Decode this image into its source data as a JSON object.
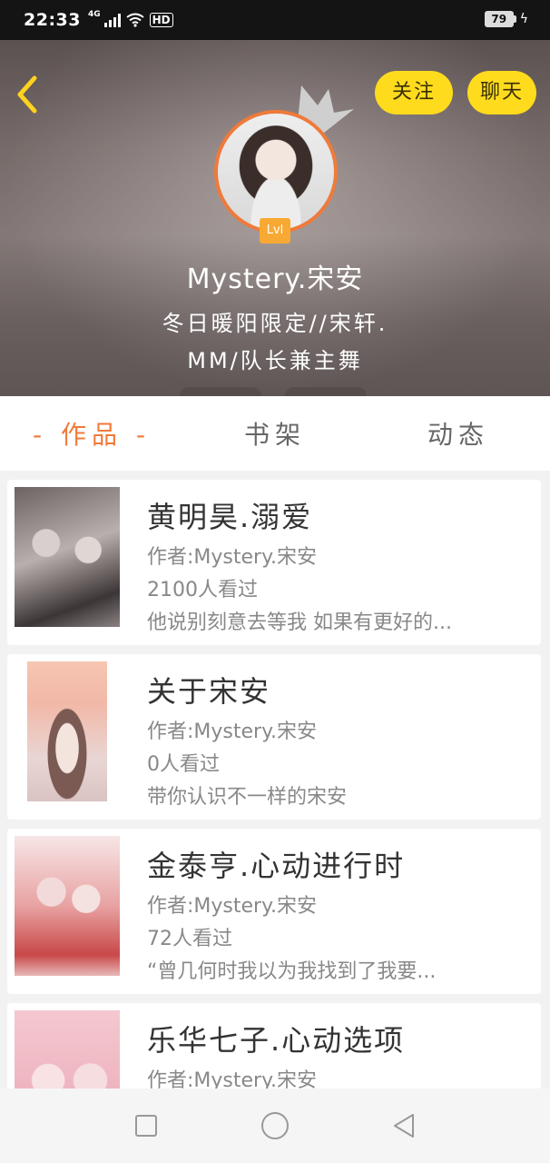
{
  "status_bar": {
    "time": "22:33",
    "network": "4G",
    "hd": "HD",
    "battery": "79"
  },
  "header": {
    "follow_label": "关注",
    "chat_label": "聊天",
    "level": "Lvl",
    "username": "Mystery.宋安",
    "bio_line1": "冬日暖阳限定//宋轩.",
    "bio_line2": "MM/队长兼主舞"
  },
  "tabs": [
    {
      "label": "- 作品 -",
      "active": true
    },
    {
      "label": "书架",
      "active": false
    },
    {
      "label": "动态",
      "active": false
    }
  ],
  "works": [
    {
      "title": "黄明昊.溺爱",
      "author": "作者:Mystery.宋安",
      "views": "2100人看过",
      "summary": "他说别刻意去等我 如果有更好的..."
    },
    {
      "title": "关于宋安",
      "author": "作者:Mystery.宋安",
      "views": "0人看过",
      "summary": "带你认识不一样的宋安"
    },
    {
      "title": "金泰亨.心动进行时",
      "author": "作者:Mystery.宋安",
      "views": "72人看过",
      "summary": "“曾几何时我以为我找到了我要..."
    },
    {
      "title": "乐华七子.心动选项",
      "author": "作者:Mystery.宋安",
      "views": "",
      "summary": ""
    }
  ],
  "colors": {
    "accent": "#f07a3a",
    "button_yellow": "#ffdb1e"
  }
}
